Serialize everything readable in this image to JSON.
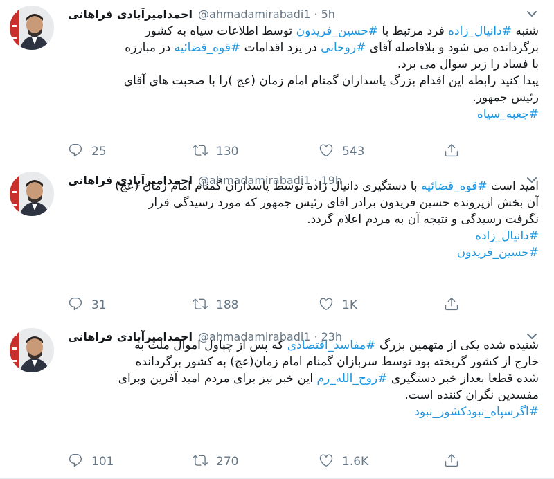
{
  "tweets": [
    {
      "name": "احمدامیرآبادی فراهانی",
      "handle": "@ahmadamirabadi1",
      "time": "5h",
      "lines": [
        [
          {
            "t": "شنبه "
          },
          {
            "t": "#دانیال_زاده",
            "tag": true
          },
          {
            "t": " فرد مرتبط با "
          },
          {
            "t": "#حسین_فریدون",
            "tag": true
          },
          {
            "t": " توسط اطلاعات سپاه به کشور"
          }
        ],
        [
          {
            "t": "برگردانده می شود و بلافاصله آقای "
          },
          {
            "t": "#روحانی",
            "tag": true
          },
          {
            "t": " در یزد اقدامات "
          },
          {
            "t": "#قوه_قضائیه",
            "tag": true
          },
          {
            "t": " در مبارزه"
          }
        ],
        [
          {
            "t": "با فساد را زیر سوال می برد."
          }
        ],
        [
          {
            "t": "پیدا کنید رابطه این اقدام بزرگ پاسداران گمنام امام زمان (عج )را با صحبت های آقای"
          }
        ],
        [
          {
            "t": "رئیس جمهور."
          }
        ],
        [
          {
            "t": "#جعبه_سیاه",
            "tag": true
          }
        ]
      ],
      "replies": "25",
      "retweets": "130",
      "likes": "543"
    },
    {
      "name": "احمدامیرآبادی فراهانی",
      "handle": "@ahmadamirabadi1",
      "time": "19h",
      "lines": [
        [
          {
            "t": "امید است "
          },
          {
            "t": "#قوه_قضائیه",
            "tag": true
          },
          {
            "t": " با دستگیری دانیال زاده توسط پاسداران گمنام امام زمان (عج)"
          }
        ],
        [
          {
            "t": "آن بخش ازپرونده حسین فریدون برادر اقای رئیس جمهور که  مورد رسیدگی قرار"
          }
        ],
        [
          {
            "t": "نگرفت رسیدگی و نتیجه آن به مردم اعلام گردد."
          }
        ],
        [
          {
            "t": "#دانیال_زاده",
            "tag": true
          }
        ],
        [
          {
            "t": "#حسین_فریدون",
            "tag": true
          }
        ]
      ],
      "replies": "31",
      "retweets": "188",
      "likes": "1K"
    },
    {
      "name": "احمدامیرآبادی فراهانی",
      "handle": "@ahmadamirabadi1",
      "time": "23h",
      "lines": [
        [
          {
            "t": "شنیده شده یکی از متهمین بزرگ "
          },
          {
            "t": "#مفاسد_اقتصادی",
            "tag": true
          },
          {
            "t": " که پس از چپاول اموال ملت به"
          }
        ],
        [
          {
            "t": "خارج از کشور گریخته بود توسط سربازان گمنام امام زمان(عج) به کشور برگردانده"
          }
        ],
        [
          {
            "t": "شده قطعا بعداز خبر دستگیری "
          },
          {
            "t": "#روح_الله_زم",
            "tag": true
          },
          {
            "t": " این خبر نیز برای مردم امید آفرین وبرای"
          }
        ],
        [
          {
            "t": "مفسدین نگران کننده است."
          }
        ],
        [
          {
            "t": "#اگرسپاه_نبودکشور_نبود",
            "tag": true
          }
        ]
      ],
      "replies": "101",
      "retweets": "270",
      "likes": "1.6K"
    }
  ]
}
